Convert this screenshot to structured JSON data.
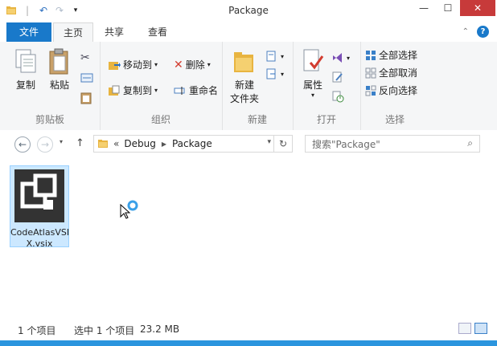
{
  "window": {
    "title": "Package"
  },
  "tabs": {
    "file": "文件",
    "home": "主页",
    "share": "共享",
    "view": "查看"
  },
  "ribbon": {
    "clipboard": {
      "label": "剪贴板",
      "copy": "复制",
      "paste": "粘贴"
    },
    "organize": {
      "label": "组织",
      "move_to": "移动到",
      "copy_to": "复制到",
      "delete": "删除",
      "rename": "重命名"
    },
    "new": {
      "label": "新建",
      "new_folder_line1": "新建",
      "new_folder_line2": "文件夹"
    },
    "open": {
      "label": "打开",
      "properties": "属性"
    },
    "select": {
      "label": "选择",
      "select_all": "全部选择",
      "select_none": "全部取消",
      "invert": "反向选择"
    }
  },
  "address": {
    "prefix": "«",
    "crumbs": [
      "Debug",
      "Package"
    ]
  },
  "search": {
    "placeholder": "搜索\"Package\""
  },
  "files": [
    {
      "name_line1": "CodeAtlasVSI",
      "name_line2": "X.vsix"
    }
  ],
  "status": {
    "count": "1 个项目",
    "selected": "选中 1 个项目",
    "size": "23.2 MB"
  },
  "colors": {
    "accent": "#1979ca",
    "selection": "#cce8ff",
    "frame": "#2b95de"
  }
}
